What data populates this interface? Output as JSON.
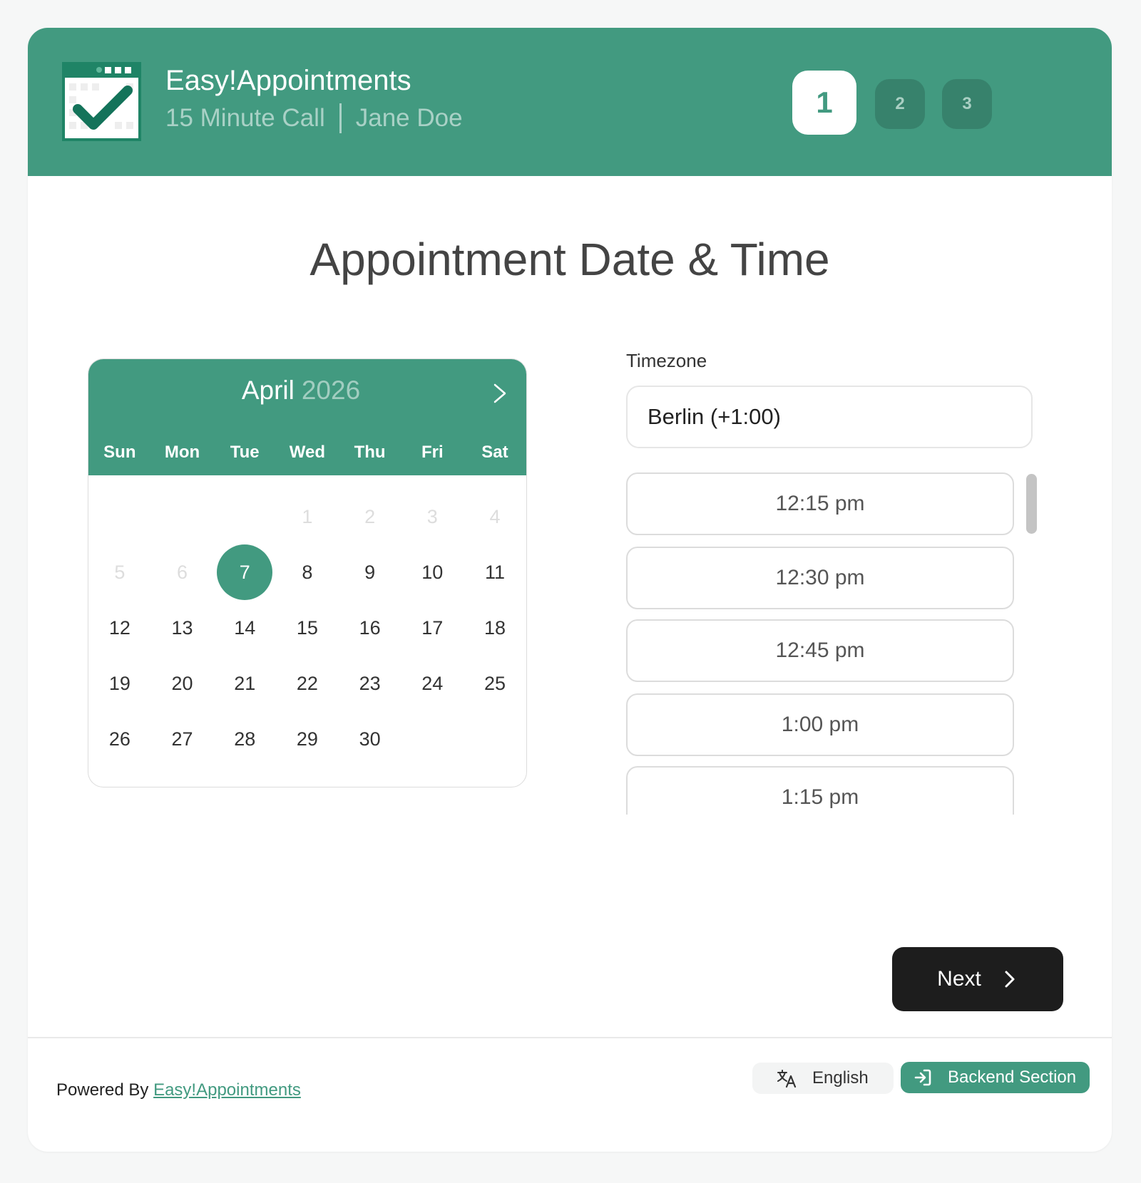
{
  "header": {
    "company_name": "Easy!Appointments",
    "service": "15 Minute Call",
    "provider": "Jane Doe",
    "steps": [
      "1",
      "2",
      "3"
    ],
    "active_step": "1"
  },
  "page_title": "Appointment Date & Time",
  "calendar": {
    "month": "April",
    "year": "2026",
    "weekdays": [
      "Sun",
      "Mon",
      "Tue",
      "Wed",
      "Thu",
      "Fri",
      "Sat"
    ],
    "days": [
      {
        "label": "",
        "state": "empty"
      },
      {
        "label": "",
        "state": "empty"
      },
      {
        "label": "",
        "state": "empty"
      },
      {
        "label": "1",
        "state": "disabled"
      },
      {
        "label": "2",
        "state": "disabled"
      },
      {
        "label": "3",
        "state": "disabled"
      },
      {
        "label": "4",
        "state": "disabled"
      },
      {
        "label": "5",
        "state": "disabled"
      },
      {
        "label": "6",
        "state": "disabled"
      },
      {
        "label": "7",
        "state": "selected"
      },
      {
        "label": "8",
        "state": "available"
      },
      {
        "label": "9",
        "state": "available"
      },
      {
        "label": "10",
        "state": "available"
      },
      {
        "label": "11",
        "state": "available"
      },
      {
        "label": "12",
        "state": "available"
      },
      {
        "label": "13",
        "state": "available"
      },
      {
        "label": "14",
        "state": "available"
      },
      {
        "label": "15",
        "state": "available"
      },
      {
        "label": "16",
        "state": "available"
      },
      {
        "label": "17",
        "state": "available"
      },
      {
        "label": "18",
        "state": "available"
      },
      {
        "label": "19",
        "state": "available"
      },
      {
        "label": "20",
        "state": "available"
      },
      {
        "label": "21",
        "state": "available"
      },
      {
        "label": "22",
        "state": "available"
      },
      {
        "label": "23",
        "state": "available"
      },
      {
        "label": "24",
        "state": "available"
      },
      {
        "label": "25",
        "state": "available"
      },
      {
        "label": "26",
        "state": "available"
      },
      {
        "label": "27",
        "state": "available"
      },
      {
        "label": "28",
        "state": "available"
      },
      {
        "label": "29",
        "state": "available"
      },
      {
        "label": "30",
        "state": "available"
      }
    ]
  },
  "timezone": {
    "label": "Timezone",
    "value": "Berlin (+1:00)"
  },
  "time_slots": [
    "12:15 pm",
    "12:30 pm",
    "12:45 pm",
    "1:00 pm",
    "1:15 pm"
  ],
  "next_label": "Next",
  "footer": {
    "powered_by": "Powered By",
    "powered_link": "Easy!Appointments",
    "language": "English",
    "backend": "Backend Section"
  },
  "colors": {
    "brand": "#429a80",
    "brand_dark": "#37826c",
    "button_dark": "#1d1d1d"
  },
  "icons": [
    "calendar-check-icon",
    "chevron-right-icon",
    "translate-icon",
    "sign-in-icon"
  ]
}
